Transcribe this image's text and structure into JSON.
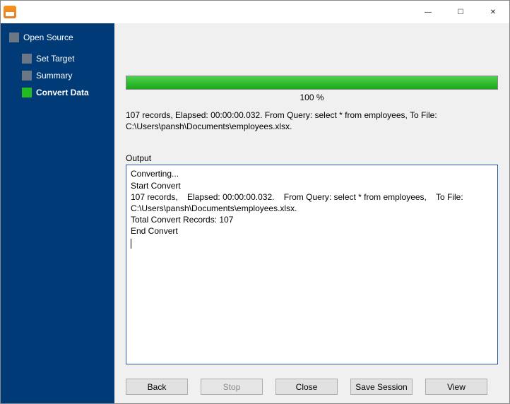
{
  "titlebar": {
    "title": ""
  },
  "window_controls": {
    "min": "—",
    "max": "☐",
    "close": "✕"
  },
  "sidebar": {
    "root_label": "Open Source",
    "items": [
      {
        "label": "Set Target",
        "active": false
      },
      {
        "label": "Summary",
        "active": false
      },
      {
        "label": "Convert Data",
        "active": true
      }
    ]
  },
  "progress": {
    "percent_text": "100 %"
  },
  "summary_text": "107 records,    Elapsed: 00:00:00.032.    From Query: select * from employees,    To File: C:\\Users\\pansh\\Documents\\employees.xlsx.",
  "output": {
    "label": "Output",
    "text": "Converting...\nStart Convert\n107 records,    Elapsed: 00:00:00.032.    From Query: select * from employees,    To File: C:\\Users\\pansh\\Documents\\employees.xlsx.\nTotal Convert Records: 107\nEnd Convert"
  },
  "buttons": {
    "back": "Back",
    "stop": "Stop",
    "close": "Close",
    "save_session": "Save Session",
    "view": "View"
  }
}
